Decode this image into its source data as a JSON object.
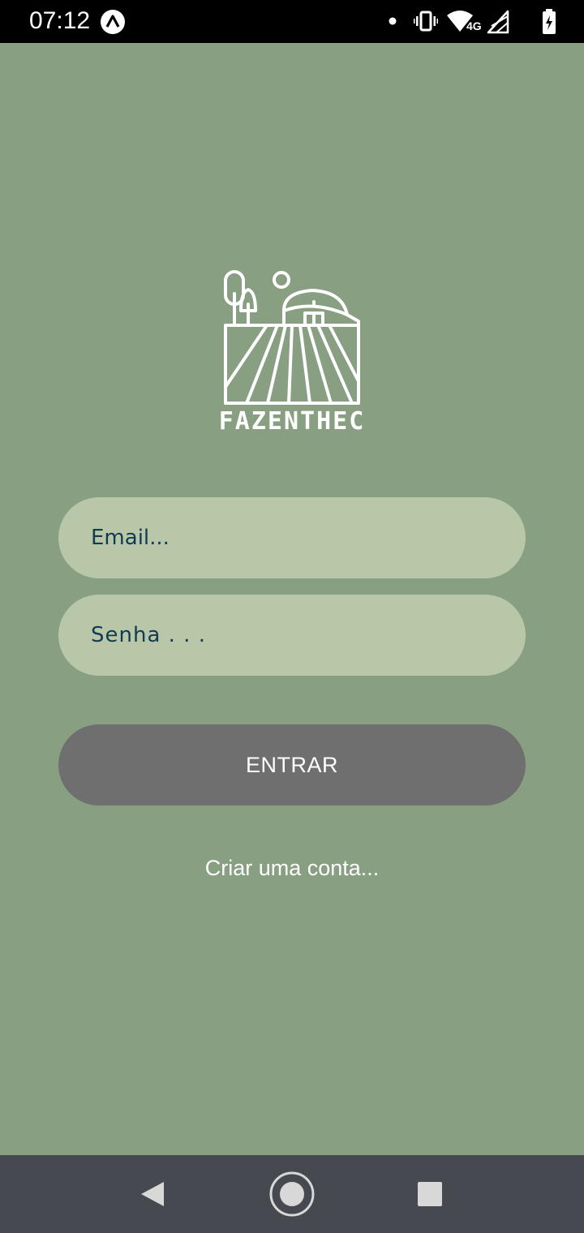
{
  "status_bar": {
    "time": "07:12",
    "network_type": "4G",
    "icons": [
      "app-notification-icon",
      "dot-icon",
      "vibrate-icon",
      "wifi-icon",
      "cell-signal-icon",
      "battery-charging-icon"
    ]
  },
  "logo": {
    "brand_name": "FAZENTHEC",
    "icon": "farm-logo-icon"
  },
  "login_form": {
    "email_placeholder": "Email...",
    "password_placeholder": "Senha . . .",
    "submit_label": "ENTRAR",
    "create_account_label": "Criar uma conta..."
  },
  "navigation_bar": {
    "icons": [
      "back-icon",
      "home-icon",
      "recents-icon"
    ]
  },
  "colors": {
    "background": "#889f81",
    "input_background": "#b8c7a8",
    "input_text": "#123b53",
    "button_background": "#6f6f6f",
    "nav_background": "#464a50"
  }
}
